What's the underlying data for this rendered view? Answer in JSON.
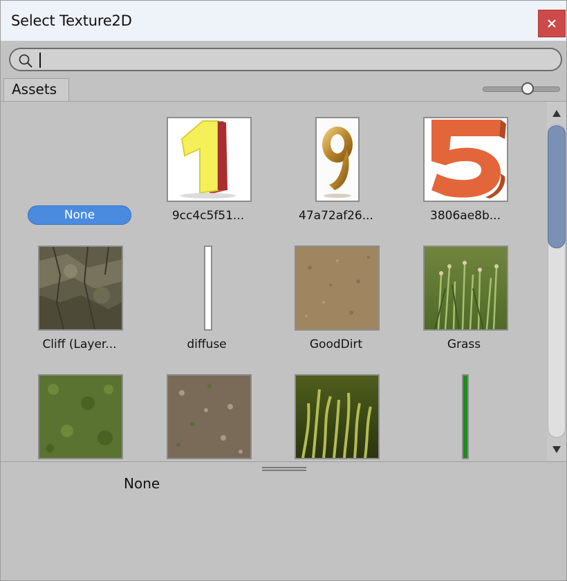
{
  "window": {
    "title": "Select Texture2D"
  },
  "search": {
    "value": "",
    "placeholder": ""
  },
  "tabs": [
    {
      "label": "Assets"
    }
  ],
  "size_slider": {
    "value": 0.6
  },
  "grid": {
    "none_item": {
      "label": "None",
      "selected": true
    },
    "items": [
      {
        "label": "9cc4c5f51...",
        "texture": "number-one"
      },
      {
        "label": "47a72af26...",
        "texture": "number-nine"
      },
      {
        "label": "3806ae8b...",
        "texture": "number-five"
      },
      {
        "label": "Cliff (Layer...",
        "texture": "rock"
      },
      {
        "label": "diffuse",
        "texture": "white-strip"
      },
      {
        "label": "GoodDirt",
        "texture": "dirt"
      },
      {
        "label": "Grass",
        "texture": "grass-tall"
      },
      {
        "label": "",
        "texture": "grass-ground"
      },
      {
        "label": "",
        "texture": "dirt-gravel"
      },
      {
        "label": "",
        "texture": "grass-blades"
      },
      {
        "label": "",
        "texture": "green-strip"
      }
    ]
  },
  "scrollbar": {
    "position": 0.0
  },
  "preview": {
    "selected_name": "None"
  },
  "colors": {
    "selection": "#4a8be0",
    "close_button": "#cc4a4a",
    "scroll_thumb": "#7a90b4"
  }
}
